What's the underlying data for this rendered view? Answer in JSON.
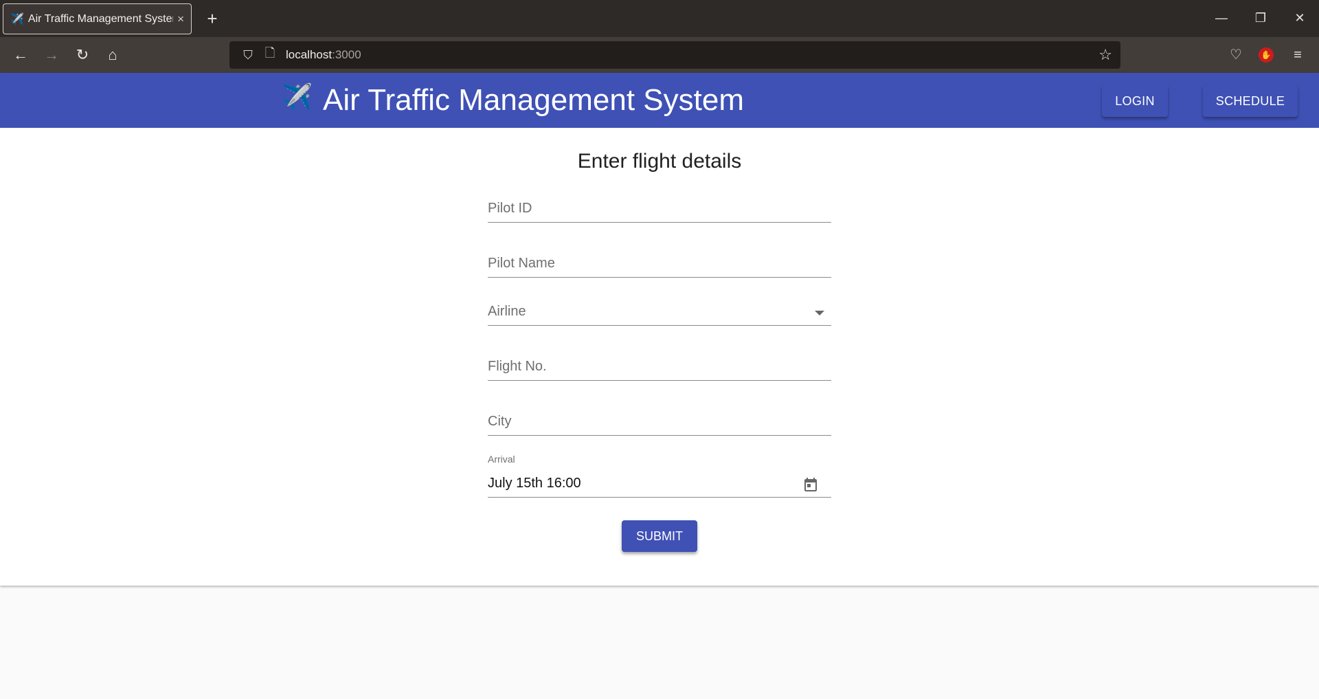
{
  "browser": {
    "tab_icon": "✈️",
    "tab_title": "Air Traffic Management System",
    "tab_close": "×",
    "new_tab": "+",
    "url_host": "localhost",
    "url_port": ":3000",
    "window_controls": {
      "minimize": "—",
      "restore": "❐",
      "close": "✕"
    }
  },
  "app": {
    "icon": "✈️",
    "title": "Air Traffic Management System",
    "nav": {
      "login": "LOGIN",
      "schedule": "SCHEDULE"
    },
    "accent_color": "#3f51b5"
  },
  "form": {
    "title": "Enter flight details",
    "pilot_id_placeholder": "Pilot ID",
    "pilot_name_placeholder": "Pilot Name",
    "airline_placeholder": "Airline",
    "flight_no_placeholder": "Flight No.",
    "city_placeholder": "City",
    "arrival_label": "Arrival",
    "arrival_value": "July 15th 16:00",
    "submit_label": "SUBMIT"
  }
}
